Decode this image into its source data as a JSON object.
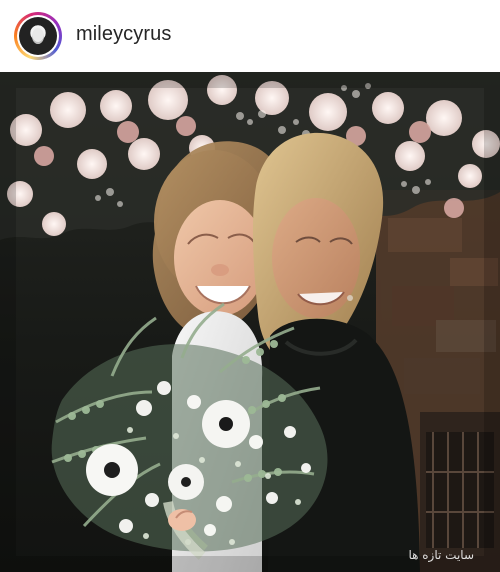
{
  "post": {
    "username": "mileycyrus",
    "avatar_alt": "profile-avatar",
    "image_alt": "post-photo",
    "watermark": "سایت تازه ها"
  },
  "colors": {
    "ring_start": "#feda75",
    "ring_mid": "#d62976",
    "ring_end": "#4f5bd5",
    "photo_bg": "#1b1d1a",
    "flowers_light": "#f1e3df",
    "rose_pink": "#d8aaa4",
    "bouquet_green": "#7f9a7d",
    "dress_white": "#ececec",
    "velvet_black": "#141614"
  }
}
